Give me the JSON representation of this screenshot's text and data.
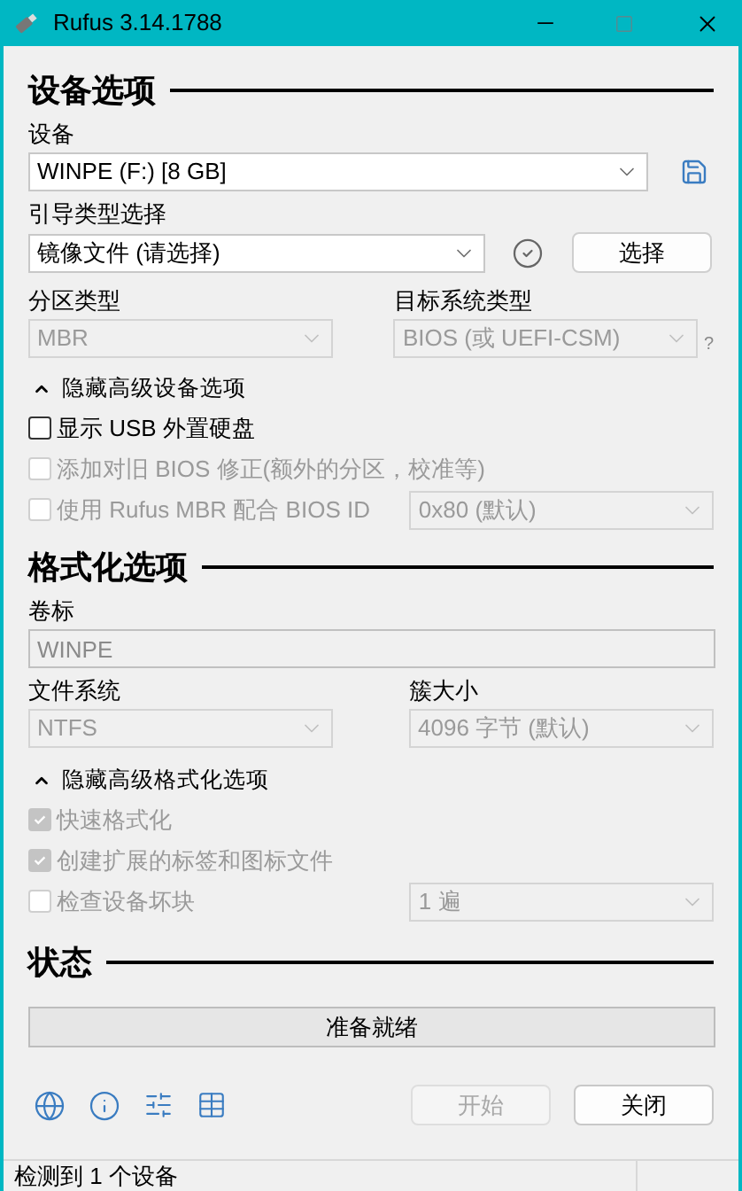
{
  "window": {
    "title": "Rufus 3.14.1788"
  },
  "device_section": {
    "heading": "设备选项",
    "device_label": "设备",
    "device": {
      "value": "WINPE (F:) [8 GB]",
      "disabled": false
    },
    "boot_label": "引导类型选择",
    "boot": {
      "value": "镜像文件 (请选择)",
      "disabled": false
    },
    "select_button": "选择",
    "partition_label": "分区类型",
    "partition": {
      "value": "MBR",
      "disabled": true
    },
    "target_label": "目标系统类型",
    "target": {
      "value": "BIOS (或 UEFI-CSM)",
      "disabled": true
    },
    "help": "?",
    "advanced": {
      "label": "隐藏高级设备选项",
      "expanded": true
    },
    "options": [
      {
        "label": "显示 USB 外置硬盘",
        "checked": false,
        "disabled": false
      },
      {
        "label": "添加对旧 BIOS 修正(额外的分区，校准等)",
        "checked": false,
        "disabled": true
      },
      {
        "label": "使用 Rufus MBR 配合 BIOS ID",
        "checked": false,
        "disabled": true,
        "select": {
          "value": "0x80 (默认)",
          "disabled": true
        }
      }
    ]
  },
  "format_section": {
    "heading": "格式化选项",
    "volume_label": "卷标",
    "volume": "WINPE",
    "fs_label": "文件系统",
    "fs": {
      "value": "NTFS",
      "disabled": true
    },
    "cluster_label": "簇大小",
    "cluster": {
      "value": "4096 字节 (默认)",
      "disabled": true
    },
    "advanced": {
      "label": "隐藏高级格式化选项",
      "expanded": true
    },
    "options": [
      {
        "label": "快速格式化",
        "checked": true,
        "disabled": true
      },
      {
        "label": "创建扩展的标签和图标文件",
        "checked": true,
        "disabled": true
      },
      {
        "label": "检查设备坏块",
        "checked": false,
        "disabled": true,
        "select": {
          "value": "1 遍",
          "disabled": true
        }
      }
    ]
  },
  "status_section": {
    "heading": "状态",
    "status": "准备就绪"
  },
  "buttons": [
    {
      "label": "开始",
      "disabled": true
    },
    {
      "label": "关闭",
      "disabled": false
    }
  ],
  "status_bar": "检测到 1 个设备"
}
